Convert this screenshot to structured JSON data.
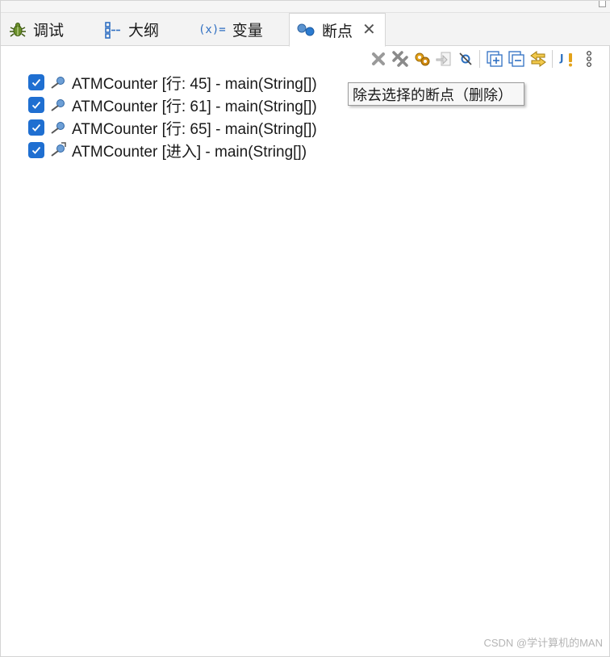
{
  "tabs": [
    {
      "label": "调试",
      "icon": "debug-bug-icon",
      "active": false
    },
    {
      "label": "大纲",
      "icon": "outline-icon",
      "active": false
    },
    {
      "label": "变量",
      "icon_text": "(x)=",
      "icon": "variables-icon",
      "active": false
    },
    {
      "label": "断点",
      "icon": "breakpoints-icon",
      "active": true
    }
  ],
  "toolbar": [
    "remove-selected-icon",
    "remove-all-icon",
    "show-supported-breakpoints-icon",
    "go-to-file-icon",
    "skip-all-breakpoints-icon",
    "expand-all-icon",
    "collapse-all-icon",
    "link-with-debug-view-icon",
    "java-exception-breakpoint-icon",
    "view-menu-icon"
  ],
  "breakpoints": [
    {
      "text": "ATMCounter [行:   45] - main(String[])",
      "checked": true,
      "icon": "line-breakpoint-icon"
    },
    {
      "text": "ATMCounter [行:   61] - main(String[])",
      "checked": true,
      "icon": "line-breakpoint-icon"
    },
    {
      "text": "ATMCounter [行:   65] - main(String[])",
      "checked": true,
      "icon": "line-breakpoint-icon"
    },
    {
      "text": "ATMCounter [进入] - main(String[])",
      "checked": true,
      "icon": "method-breakpoint-icon"
    }
  ],
  "tooltip": "除去选择的断点（删除）",
  "watermark": "CSDN @学计算机的MAN",
  "colors": {
    "accent": "#1f6fd1",
    "tab_bar": "#f3f3f3"
  }
}
